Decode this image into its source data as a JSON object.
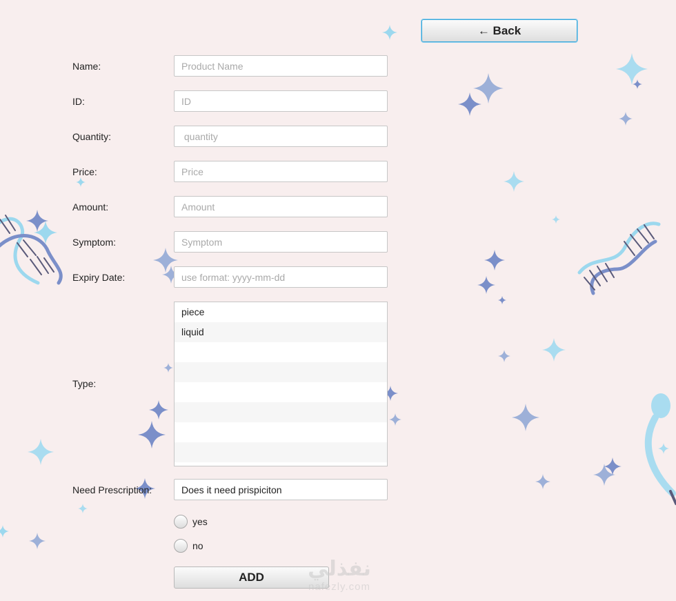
{
  "header": {
    "back_label": "← Back"
  },
  "form": {
    "name": {
      "label": "Name:",
      "placeholder": "Product Name"
    },
    "id": {
      "label": "ID:",
      "placeholder": "ID"
    },
    "quantity": {
      "label": "Quantity:",
      "placeholder": " quantity"
    },
    "price": {
      "label": "Price:",
      "placeholder": "Price"
    },
    "amount": {
      "label": "Amount:",
      "placeholder": "Amount"
    },
    "symptom": {
      "label": "Symptom:",
      "placeholder": "Symptom"
    },
    "expiry": {
      "label": "Expiry Date:",
      "placeholder": "use format: yyyy-mm-dd"
    },
    "type": {
      "label": "Type:",
      "options": [
        "piece",
        "liquid"
      ]
    },
    "prescription": {
      "label": "Need Prescription:",
      "value": "Does it need prispiciton"
    },
    "radio_yes": "yes",
    "radio_no": "no",
    "add_label": "ADD"
  },
  "watermark": {
    "arabic": "نفذلي",
    "latin": "nafezly.com"
  },
  "colors": {
    "background": "#f8eeee",
    "sparkle_blue": "#7b8fc9",
    "sparkle_cyan": "#9cd8ee",
    "button_focus": "#39a6d9"
  }
}
